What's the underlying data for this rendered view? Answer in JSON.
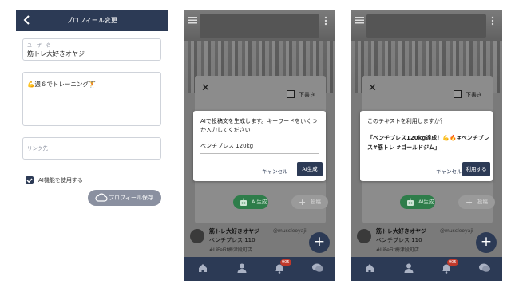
{
  "screen1": {
    "title": "プロフィール変更",
    "username_label": "ユーザー名",
    "username_value": "筋トレ大好きオヤジ",
    "bio_value": "💪週６でトレーニング🏋",
    "link_placeholder": "リンク先",
    "ai_feature_label": "AI機能を使用する",
    "ai_feature_checked": true,
    "save_label": "プロフィール保存"
  },
  "screen2": {
    "draft_label": "下書き",
    "dialog_text": "AIで投稿文を生成します。キーワードをいくつか入力してください",
    "keyword_value": "ベンチプレス 120kg",
    "cancel_label": "キャンセル",
    "generate_label": "AI生成",
    "ai_button_label": "AI生成",
    "post_button_label": "投稿"
  },
  "screen3": {
    "draft_label": "下書き",
    "dialog_question": "このテキストを利用しますか？",
    "generated_line1": "「ベンチプレス120kg達成！💪🔥#ベンチプレ",
    "generated_line2": "ス#筋トレ #ゴールドジム」",
    "cancel_label": "キャンセル",
    "use_label": "利用する",
    "ai_button_label": "AI生成",
    "post_button_label": "投稿"
  },
  "feed_post": {
    "user_name": "筋トレ大好きオヤジ",
    "handle": "@muscleoyaji",
    "body": "ベンチプレス 110",
    "location": "#LiFeFit梅津段町店"
  },
  "tabbar": {
    "badge_count": "905"
  },
  "colors": {
    "navy": "#2c3a55",
    "green": "#2e7d4a",
    "badge_red": "#c0392b"
  }
}
